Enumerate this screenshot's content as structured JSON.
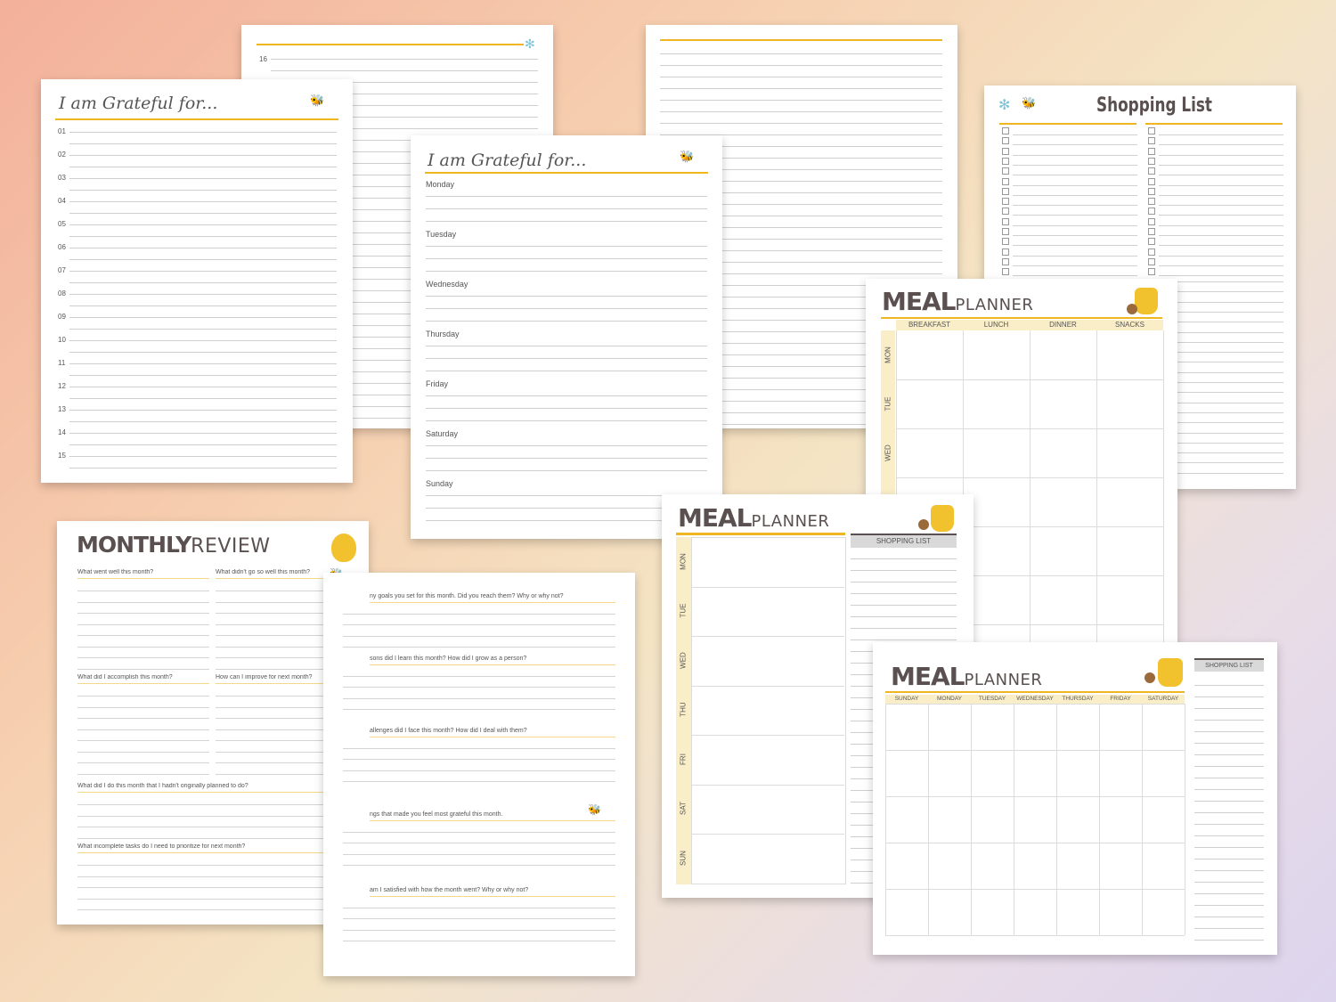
{
  "colors": {
    "accent": "#f0b622",
    "text": "#5a5050",
    "cell_fill": "#faeec8",
    "header_bar": "#d9d9d9"
  },
  "grateful_list": {
    "title": "I am Grateful for...",
    "numbers": [
      "01",
      "02",
      "03",
      "04",
      "05",
      "06",
      "07",
      "08",
      "09",
      "10",
      "11",
      "12",
      "13",
      "14",
      "15"
    ],
    "next_number": "16"
  },
  "grateful_week": {
    "title": "I am Grateful for...",
    "days": [
      "Monday",
      "Tuesday",
      "Wednesday",
      "Thursday",
      "Friday",
      "Saturday",
      "Sunday"
    ]
  },
  "shopping_list": {
    "title": "Shopping List"
  },
  "meal_weekly": {
    "brand_big": "MEAL",
    "brand_small": "PLANNER",
    "columns": [
      "BREAKFAST",
      "LUNCH",
      "DINNER",
      "SNACKS"
    ],
    "rows": [
      "MON",
      "TUE",
      "WED"
    ]
  },
  "meal_daily": {
    "brand_big": "MEAL",
    "brand_small": "PLANNER",
    "shopping_label": "SHOPPING LIST",
    "days": [
      "MON",
      "TUE",
      "WED",
      "THU",
      "FRI",
      "SAT",
      "SUN"
    ]
  },
  "meal_month": {
    "brand_big": "MEAL",
    "brand_small": "PLANNER",
    "shopping_label": "SHOPPING LIST",
    "days": [
      "SUNDAY",
      "MONDAY",
      "TUESDAY",
      "WEDNESDAY",
      "THURSDAY",
      "FRIDAY",
      "SATURDAY"
    ]
  },
  "monthly_review": {
    "brand_big": "MONTHLY",
    "brand_small": "REVIEW",
    "q1": "What went well this month?",
    "q2": "What didn't go so well this month?",
    "q3": "What did I accomplish this month?",
    "q4": "How can I improve for next month?",
    "q5": "What did I do this month that I hadn't originally planned to do?",
    "q6": "What incomplete tasks do I need to prioritize for next month?"
  },
  "monthly_review_2": {
    "q1": "ny goals you set for this month. Did you reach them? Why or why not?",
    "q2": "sons did I learn this month? How did I grow as a person?",
    "q3": "allenges did I face this month? How did I deal with them?",
    "q4": "ngs that made you feel most grateful this month.",
    "q5": "am I satisfied with how the month went? Why or why not?"
  }
}
